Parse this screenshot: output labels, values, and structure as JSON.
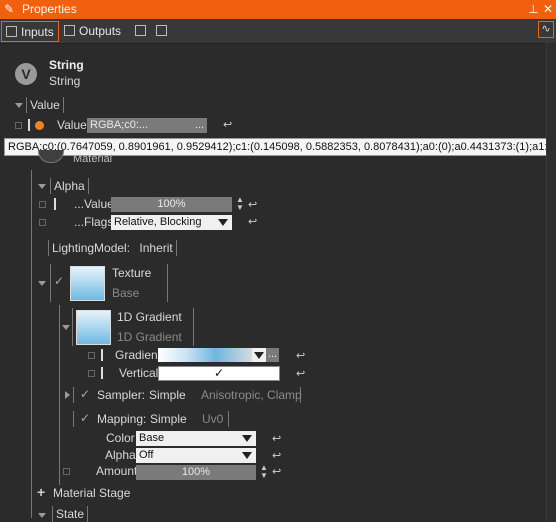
{
  "window": {
    "title": "Properties"
  },
  "toolbar": {
    "inputs_label": "Inputs",
    "outputs_label": "Outputs"
  },
  "header": {
    "title": "String",
    "subtitle": "String"
  },
  "value_group": {
    "label": "Value",
    "field_label": "Value",
    "field_value": "RGBA;c0:...",
    "ellipsis": "..."
  },
  "tooltip": {
    "text": "RGBA;c0:(0.7647059, 0.8901961, 0.9529412);c1:(0.145098, 0.5882353, 0.8078431);a0:(0);a0.4431373:(1);a1:(0)"
  },
  "material": {
    "label": "Material"
  },
  "alpha": {
    "label": "Alpha",
    "value_label": "...Value",
    "value": "100%",
    "flags_label": "...Flags",
    "flags_value": "Relative, Blocking"
  },
  "lighting": {
    "label": "LightingModel:",
    "value": "Inherit"
  },
  "texture": {
    "title": "Texture",
    "subtitle": "Base"
  },
  "gradient1d": {
    "title": "1D Gradient",
    "subtitle": "1D Gradient",
    "gradient_label": "Gradient",
    "gradient_ellipsis": "...",
    "vertical_label": "Vertical",
    "vertical_check": "✓"
  },
  "sampler": {
    "label": "Sampler:",
    "value": "Simple",
    "detail": "Anisotropic, Clamp"
  },
  "mapping": {
    "label": "Mapping:",
    "value": "Simple",
    "detail": "Uv0"
  },
  "color": {
    "label": "Color",
    "value": "Base"
  },
  "alpha2": {
    "label": "Alpha",
    "value": "Off"
  },
  "amount": {
    "label": "Amount",
    "value": "100%"
  },
  "material_stage": {
    "label": "Material Stage"
  },
  "state": {
    "label": "State"
  },
  "colors": {
    "accent": "#f1600f",
    "background": "#2b2b2b",
    "toolbar": "#383838",
    "orange_dot": "#f5821f"
  }
}
